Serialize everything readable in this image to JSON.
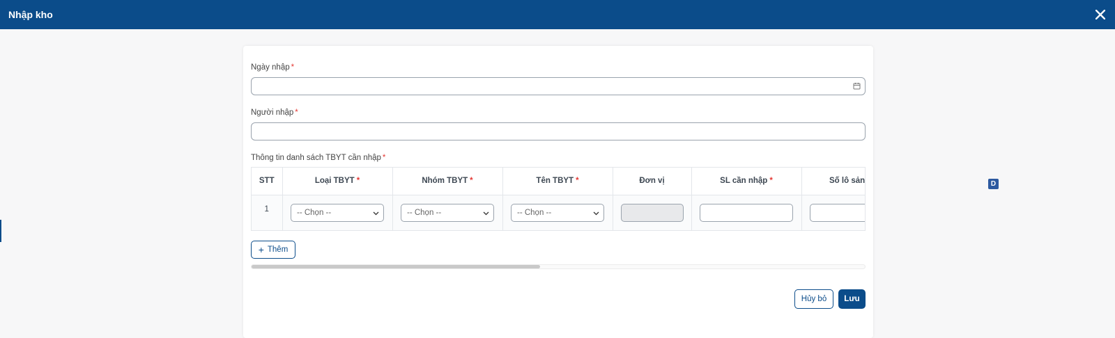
{
  "header": {
    "title": "Nhập kho",
    "close_icon": "close-icon"
  },
  "form": {
    "date_label": "Ngày nhập",
    "date_value": "",
    "user_label": "Người nhập",
    "user_value": "",
    "list_label": "Thông tin danh sách TBYT cần nhập",
    "required_mark": "*"
  },
  "table": {
    "columns": [
      "STT",
      "Loại TBYT",
      "Nhóm TBYT",
      "Tên TBYT",
      "Đơn vị",
      "SL cần nhập",
      "Số lô sản xuất"
    ],
    "required_columns": [
      "Loại TBYT",
      "Nhóm TBYT",
      "Tên TBYT",
      "SL cần nhập"
    ],
    "rows": [
      {
        "stt": "1",
        "loai": "-- Chọn --",
        "nhom": "-- Chọn --",
        "ten": "-- Chọn --",
        "don_vi": "",
        "sl": "",
        "so_lo": ""
      }
    ],
    "horizontal_scroll_fraction": 0.47
  },
  "actions": {
    "add_label": "Thêm",
    "cancel_label": "Hủy bỏ",
    "save_label": "Lưu"
  },
  "badge": {
    "label": "D"
  },
  "colors": {
    "primary": "#0b4c8a",
    "required": "#e53935",
    "background": "#f7f7f8"
  }
}
